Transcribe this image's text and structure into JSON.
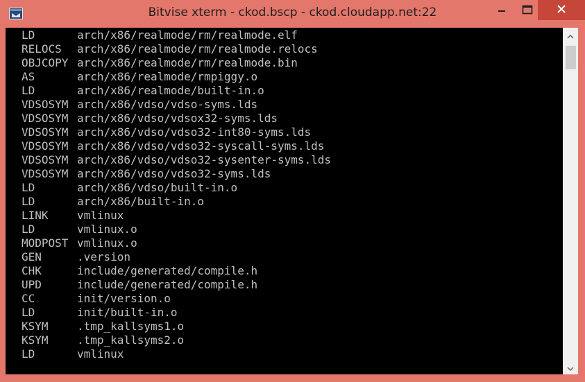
{
  "window": {
    "title": "Bitvise xterm - ckod.bscp - ckod.cloudapp.net:22"
  },
  "terminal": {
    "lines": [
      {
        "cmd": "LD",
        "arg": "arch/x86/realmode/rm/realmode.elf"
      },
      {
        "cmd": "RELOCS",
        "arg": "arch/x86/realmode/rm/realmode.relocs"
      },
      {
        "cmd": "OBJCOPY",
        "arg": "arch/x86/realmode/rm/realmode.bin"
      },
      {
        "cmd": "AS",
        "arg": "arch/x86/realmode/rmpiggy.o"
      },
      {
        "cmd": "LD",
        "arg": "arch/x86/realmode/built-in.o"
      },
      {
        "cmd": "VDSOSYM",
        "arg": "arch/x86/vdso/vdso-syms.lds"
      },
      {
        "cmd": "VDSOSYM",
        "arg": "arch/x86/vdso/vdsox32-syms.lds"
      },
      {
        "cmd": "VDSOSYM",
        "arg": "arch/x86/vdso/vdso32-int80-syms.lds"
      },
      {
        "cmd": "VDSOSYM",
        "arg": "arch/x86/vdso/vdso32-syscall-syms.lds"
      },
      {
        "cmd": "VDSOSYM",
        "arg": "arch/x86/vdso/vdso32-sysenter-syms.lds"
      },
      {
        "cmd": "VDSOSYM",
        "arg": "arch/x86/vdso/vdso32-syms.lds"
      },
      {
        "cmd": "LD",
        "arg": "arch/x86/vdso/built-in.o"
      },
      {
        "cmd": "LD",
        "arg": "arch/x86/built-in.o"
      },
      {
        "cmd": "LINK",
        "arg": "vmlinux"
      },
      {
        "cmd": "LD",
        "arg": "vmlinux.o"
      },
      {
        "cmd": "MODPOST",
        "arg": "vmlinux.o"
      },
      {
        "cmd": "GEN",
        "arg": ".version"
      },
      {
        "cmd": "CHK",
        "arg": "include/generated/compile.h"
      },
      {
        "cmd": "UPD",
        "arg": "include/generated/compile.h"
      },
      {
        "cmd": "CC",
        "arg": "init/version.o"
      },
      {
        "cmd": "LD",
        "arg": "init/built-in.o"
      },
      {
        "cmd": "KSYM",
        "arg": ".tmp_kallsyms1.o"
      },
      {
        "cmd": "KSYM",
        "arg": ".tmp_kallsyms2.o"
      },
      {
        "cmd": "LD",
        "arg": "vmlinux"
      }
    ]
  },
  "icons": {
    "app": "bitvise-terminal-icon",
    "minimize": "minimize-icon",
    "maximize": "maximize-icon",
    "close": "close-icon",
    "scroll_up": "chevron-up-icon",
    "scroll_down": "chevron-down-icon"
  },
  "colors": {
    "frame": "#e4776b",
    "close_button": "#c7463a",
    "terminal_bg": "#000000",
    "terminal_fg": "#c0c0c0"
  }
}
